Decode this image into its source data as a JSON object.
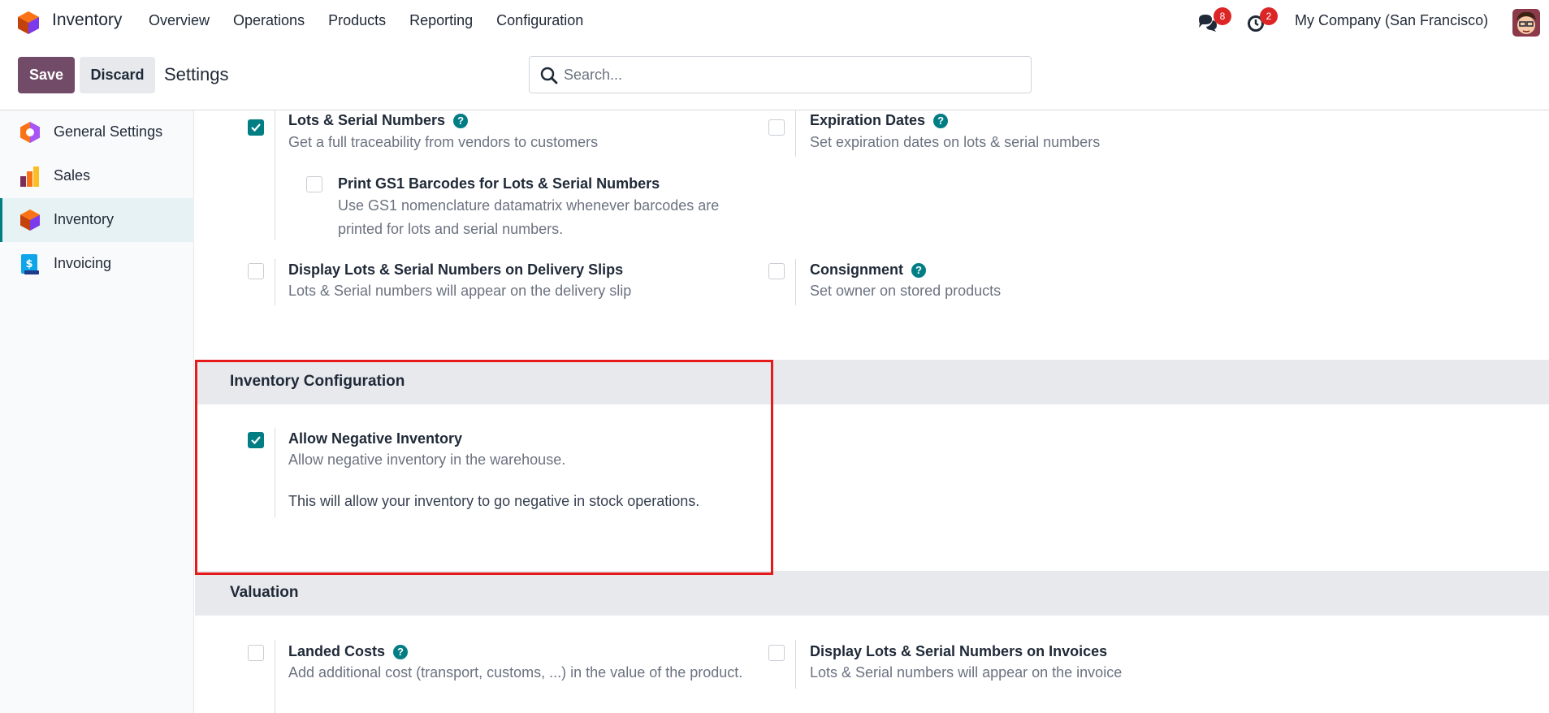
{
  "app": {
    "name": "Inventory",
    "menu": [
      "Overview",
      "Operations",
      "Products",
      "Reporting",
      "Configuration"
    ]
  },
  "systray": {
    "messages_count": "8",
    "activities_count": "2",
    "company": "My Company (San Francisco)"
  },
  "control_panel": {
    "save_label": "Save",
    "discard_label": "Discard",
    "title": "Settings",
    "search_placeholder": "Search..."
  },
  "sidebar": {
    "items": [
      {
        "label": "General Settings",
        "icon": "general-settings-icon"
      },
      {
        "label": "Sales",
        "icon": "sales-icon"
      },
      {
        "label": "Inventory",
        "icon": "inventory-icon",
        "active": true
      },
      {
        "label": "Invoicing",
        "icon": "invoicing-icon"
      }
    ]
  },
  "settings": {
    "lots": {
      "title": "Lots & Serial Numbers",
      "desc": "Get a full traceability from vendors to customers",
      "checked": true
    },
    "expiration": {
      "title": "Expiration Dates",
      "desc": "Set expiration dates on lots & serial numbers",
      "checked": false
    },
    "gs1": {
      "title": "Print GS1 Barcodes for Lots & Serial Numbers",
      "desc": "Use GS1 nomenclature datamatrix whenever barcodes are printed for lots and serial numbers.",
      "checked": false
    },
    "delivery_slips": {
      "title": "Display Lots & Serial Numbers on Delivery Slips",
      "desc": "Lots & Serial numbers will appear on the delivery slip",
      "checked": false
    },
    "consignment": {
      "title": "Consignment",
      "desc": "Set owner on stored products",
      "checked": false
    }
  },
  "inventory_config": {
    "title": "Inventory Configuration",
    "negative": {
      "title": "Allow Negative Inventory",
      "desc": "Allow negative inventory in the warehouse.",
      "note": "This will allow your inventory to go negative in stock operations.",
      "checked": true
    }
  },
  "valuation": {
    "title": "Valuation",
    "landed_costs": {
      "title": "Landed Costs",
      "desc": "Add additional cost (transport, customs, ...) in the value of the product.",
      "checked": false
    },
    "invoices": {
      "title": "Display Lots & Serial Numbers on Invoices",
      "desc": "Lots & Serial numbers will appear on the invoice",
      "checked": false
    }
  },
  "help_glyph": "?",
  "colors": {
    "brand": "#714b67",
    "accent": "#017e84",
    "badge": "#dc2626",
    "highlight": "#e51a1a"
  }
}
